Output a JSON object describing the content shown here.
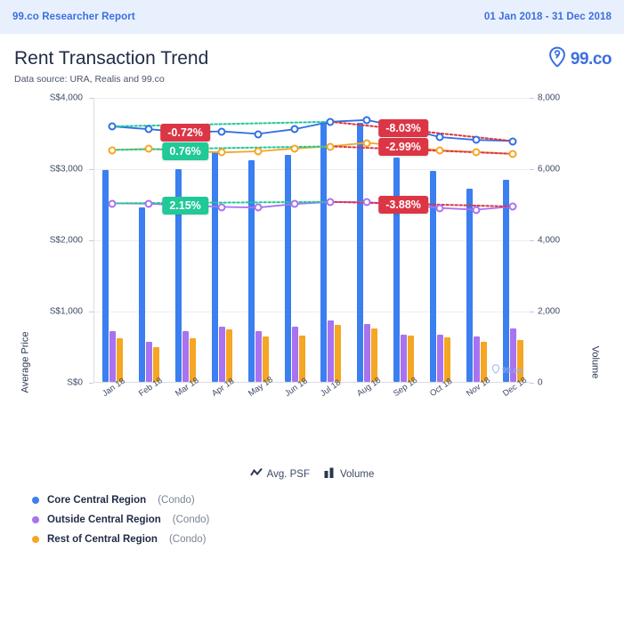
{
  "topbar": {
    "title": "99.co Researcher Report",
    "date_range": "01 Jan 2018 - 31 Dec 2018",
    "background_color": "#e9f0fd",
    "text_color": "#3b6fe0"
  },
  "header": {
    "title": "Rent Transaction Trend",
    "subtitle": "Data source: URA, Realis and 99.co",
    "logo_text": "99.co",
    "logo_icon": "location-pin-icon"
  },
  "type_legend": [
    {
      "label": "Avg. PSF",
      "icon": "line-chart-icon"
    },
    {
      "label": "Volume",
      "icon": "bar-chart-icon"
    }
  ],
  "watermark": {
    "text": "99.co",
    "icon": "location-pin-icon",
    "color": "#8fb3f0"
  },
  "chart_data": {
    "type": "line",
    "title": "Rent Transaction Trend",
    "subtitle": "Data source: URA, Realis and 99.co",
    "xlabel": "",
    "ylabel": "Average Price",
    "y2label": "Volume",
    "grid": true,
    "legend_position": "bottom-left",
    "categories": [
      "Jan 18",
      "Feb 18",
      "Mar 18",
      "Apr 18",
      "May 18",
      "Jun 18",
      "Jul 18",
      "Aug 18",
      "Sep 18",
      "Oct 18",
      "Nov 18",
      "Dec 18"
    ],
    "ylim": [
      0,
      4000
    ],
    "yticks": [
      "S$0",
      "S$1,000",
      "S$2,000",
      "S$3,000",
      "S$4,000"
    ],
    "ytick_values": [
      0,
      1000,
      2000,
      3000,
      4000
    ],
    "y2lim": [
      0,
      8000
    ],
    "y2ticks": [
      "0",
      "2,000",
      "4,000",
      "6,000",
      "8,000"
    ],
    "y2tick_values": [
      0,
      2000,
      4000,
      6000,
      8000
    ],
    "series": [
      {
        "name": "Core Central Region",
        "sub": "(Condo)",
        "color": "#3b7ff0",
        "line_color": "#2f6fe4",
        "axis": "left",
        "kind": "line",
        "values": [
          3600,
          3560,
          3520,
          3530,
          3495,
          3560,
          3665,
          3690,
          3580,
          3450,
          3410,
          3395
        ],
        "trend_change": "-8.03%",
        "trend_sign": "neg"
      },
      {
        "name": "Outside Central Region",
        "sub": "(Condo)",
        "color": "#a872f0",
        "line_color": "#a872f0",
        "axis": "left",
        "kind": "line",
        "values": [
          2520,
          2515,
          2490,
          2470,
          2460,
          2510,
          2540,
          2535,
          2505,
          2455,
          2430,
          2475
        ],
        "trend_change": "-3.88%",
        "trend_sign": "neg"
      },
      {
        "name": "Rest of Central Region",
        "sub": "(Condo)",
        "color": "#f5a623",
        "line_color": "#f5a623",
        "axis": "left",
        "kind": "line",
        "values": [
          3270,
          3285,
          3255,
          3235,
          3250,
          3290,
          3320,
          3370,
          3320,
          3265,
          3240,
          3215
        ],
        "trend_change": "-2.99%",
        "trend_sign": "neg"
      }
    ],
    "volume_series": [
      {
        "name": "Core Central Region",
        "color": "#3b7ff0",
        "values": [
          5960,
          4900,
          5970,
          6450,
          6230,
          6390,
          7300,
          7290,
          6310,
          5930,
          5420,
          5680
        ]
      },
      {
        "name": "Outside Central Region",
        "color": "#a872f0",
        "values": [
          1430,
          1130,
          1420,
          1560,
          1420,
          1550,
          1720,
          1640,
          1340,
          1320,
          1290,
          1510
        ]
      },
      {
        "name": "Rest of Central Region",
        "color": "#f5a623",
        "values": [
          1230,
          990,
          1220,
          1480,
          1270,
          1300,
          1610,
          1510,
          1300,
          1250,
          1120,
          1170
        ]
      }
    ],
    "annotations": [
      {
        "text": "-0.72%",
        "sign": "neg",
        "series": "Core Central Region",
        "side": "left"
      },
      {
        "text": "0.76%",
        "sign": "pos",
        "series": "Rest of Central Region",
        "side": "left"
      },
      {
        "text": "2.15%",
        "sign": "pos",
        "series": "Outside Central Region",
        "side": "left"
      },
      {
        "text": "-8.03%",
        "sign": "neg",
        "series": "Core Central Region",
        "side": "right"
      },
      {
        "text": "-2.99%",
        "sign": "neg",
        "series": "Rest of Central Region",
        "side": "right"
      },
      {
        "text": "-3.88%",
        "sign": "neg",
        "series": "Outside Central Region",
        "side": "right"
      }
    ]
  }
}
